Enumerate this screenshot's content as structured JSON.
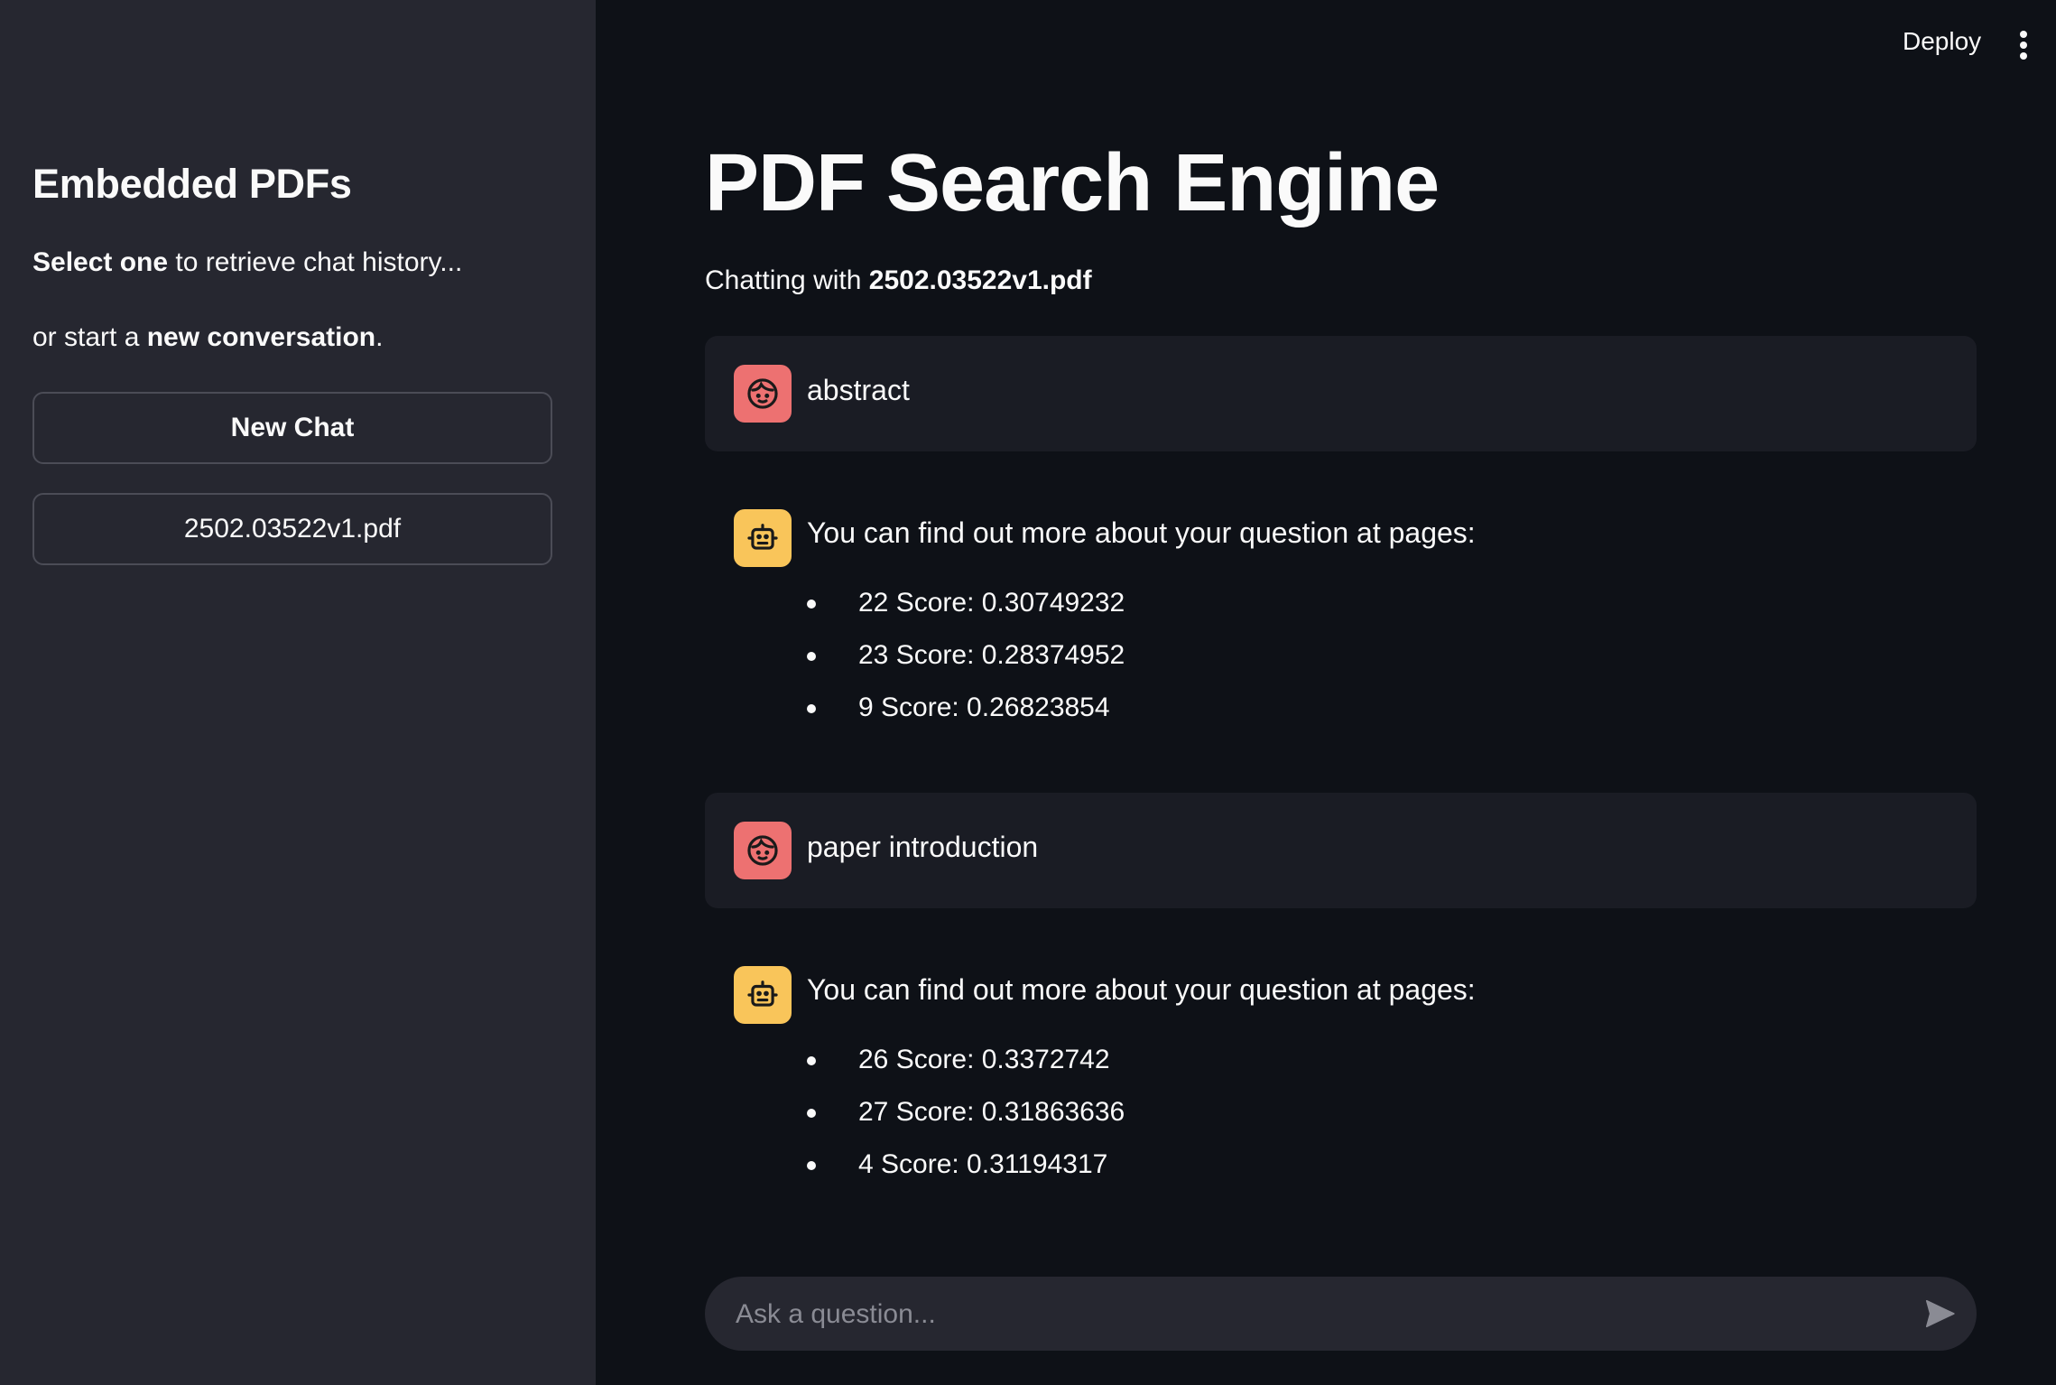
{
  "sidebar": {
    "title": "Embedded PDFs",
    "line1_bold": "Select one",
    "line1_rest": " to retrieve chat history...",
    "line2_start": "or start a ",
    "line2_bold": "new conversation",
    "line2_end": ".",
    "new_chat_label": "New Chat",
    "files": [
      "2502.03522v1.pdf"
    ]
  },
  "header": {
    "deploy_label": "Deploy",
    "menu_icon": "vertical-dots-icon"
  },
  "main": {
    "title": "PDF Search Engine",
    "chatting_prefix": "Chatting with ",
    "chatting_file": "2502.03522v1.pdf"
  },
  "messages": [
    {
      "role": "user",
      "avatar_icon": "user-face-icon",
      "text": "abstract"
    },
    {
      "role": "assistant",
      "avatar_icon": "robot-icon",
      "text": "You can find out more about your question at pages:",
      "items": [
        "22 Score: 0.30749232",
        "23 Score: 0.28374952",
        "9 Score: 0.26823854"
      ]
    },
    {
      "role": "user",
      "avatar_icon": "user-face-icon",
      "text": "paper introduction"
    },
    {
      "role": "assistant",
      "avatar_icon": "robot-icon",
      "text": "You can find out more about your question at pages:",
      "items": [
        "26 Score: 0.3372742",
        "27 Score: 0.31863636",
        "4 Score: 0.31194317"
      ]
    }
  ],
  "chat_input": {
    "placeholder": "Ask a question...",
    "send_icon": "send-arrow-icon"
  },
  "colors": {
    "background": "#0e1117",
    "sidebar": "#262730",
    "user_avatar": "#ed7171",
    "bot_avatar": "#f9c55a"
  }
}
